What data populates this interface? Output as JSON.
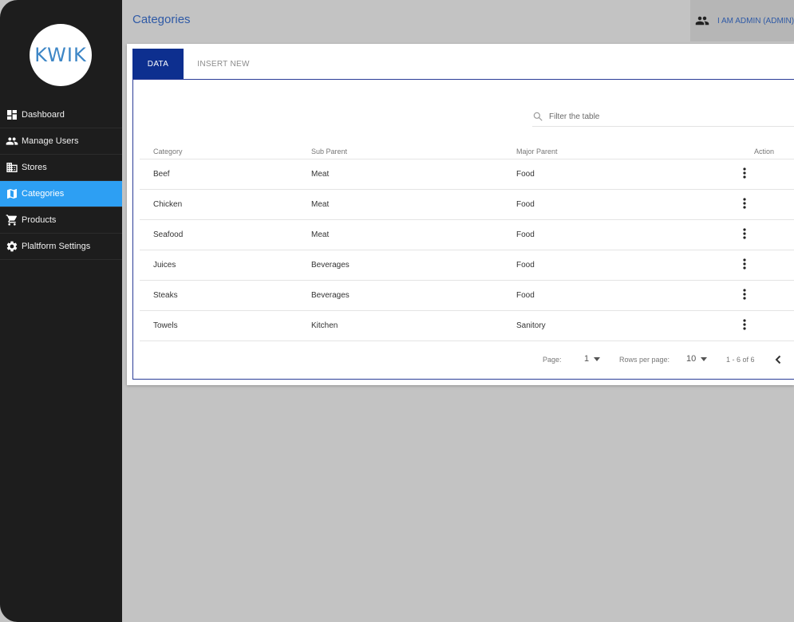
{
  "logo": {
    "text": "KWIK"
  },
  "sidebar": {
    "items": [
      {
        "label": "Dashboard",
        "icon": "dashboard-icon",
        "active": false
      },
      {
        "label": "Manage Users",
        "icon": "users-icon",
        "active": false
      },
      {
        "label": "Stores",
        "icon": "building-icon",
        "active": false
      },
      {
        "label": "Categories",
        "icon": "map-icon",
        "active": true
      },
      {
        "label": "Products",
        "icon": "cart-icon",
        "active": false
      },
      {
        "label": "Plaltform Settings",
        "icon": "gear-icon",
        "active": false
      }
    ]
  },
  "header": {
    "title": "Categories",
    "user": "I AM ADMIN (ADMIN)"
  },
  "tabs": {
    "data": "DATA",
    "insert": "INSERT NEW"
  },
  "filter": {
    "placeholder": "Filter the table"
  },
  "table": {
    "headers": {
      "category": "Category",
      "sub_parent": "Sub Parent",
      "major_parent": "Major Parent",
      "action": "Action"
    },
    "rows": [
      {
        "category": "Beef",
        "sub_parent": "Meat",
        "major_parent": "Food"
      },
      {
        "category": "Chicken",
        "sub_parent": "Meat",
        "major_parent": "Food"
      },
      {
        "category": "Seafood",
        "sub_parent": "Meat",
        "major_parent": "Food"
      },
      {
        "category": "Juices",
        "sub_parent": "Beverages",
        "major_parent": "Food"
      },
      {
        "category": "Steaks",
        "sub_parent": "Beverages",
        "major_parent": "Food"
      },
      {
        "category": "Towels",
        "sub_parent": "Kitchen",
        "major_parent": "Sanitory"
      }
    ]
  },
  "pagination": {
    "page_label": "Page:",
    "page_value": "1",
    "rows_label": "Rows per page:",
    "rows_value": "10",
    "range": "1 - 6 of 6"
  },
  "colors": {
    "sidebar_bg": "#1d1d1d",
    "active_nav": "#2d9ff3",
    "tab_active": "#0d2f8f",
    "title": "#2f5aa6"
  }
}
